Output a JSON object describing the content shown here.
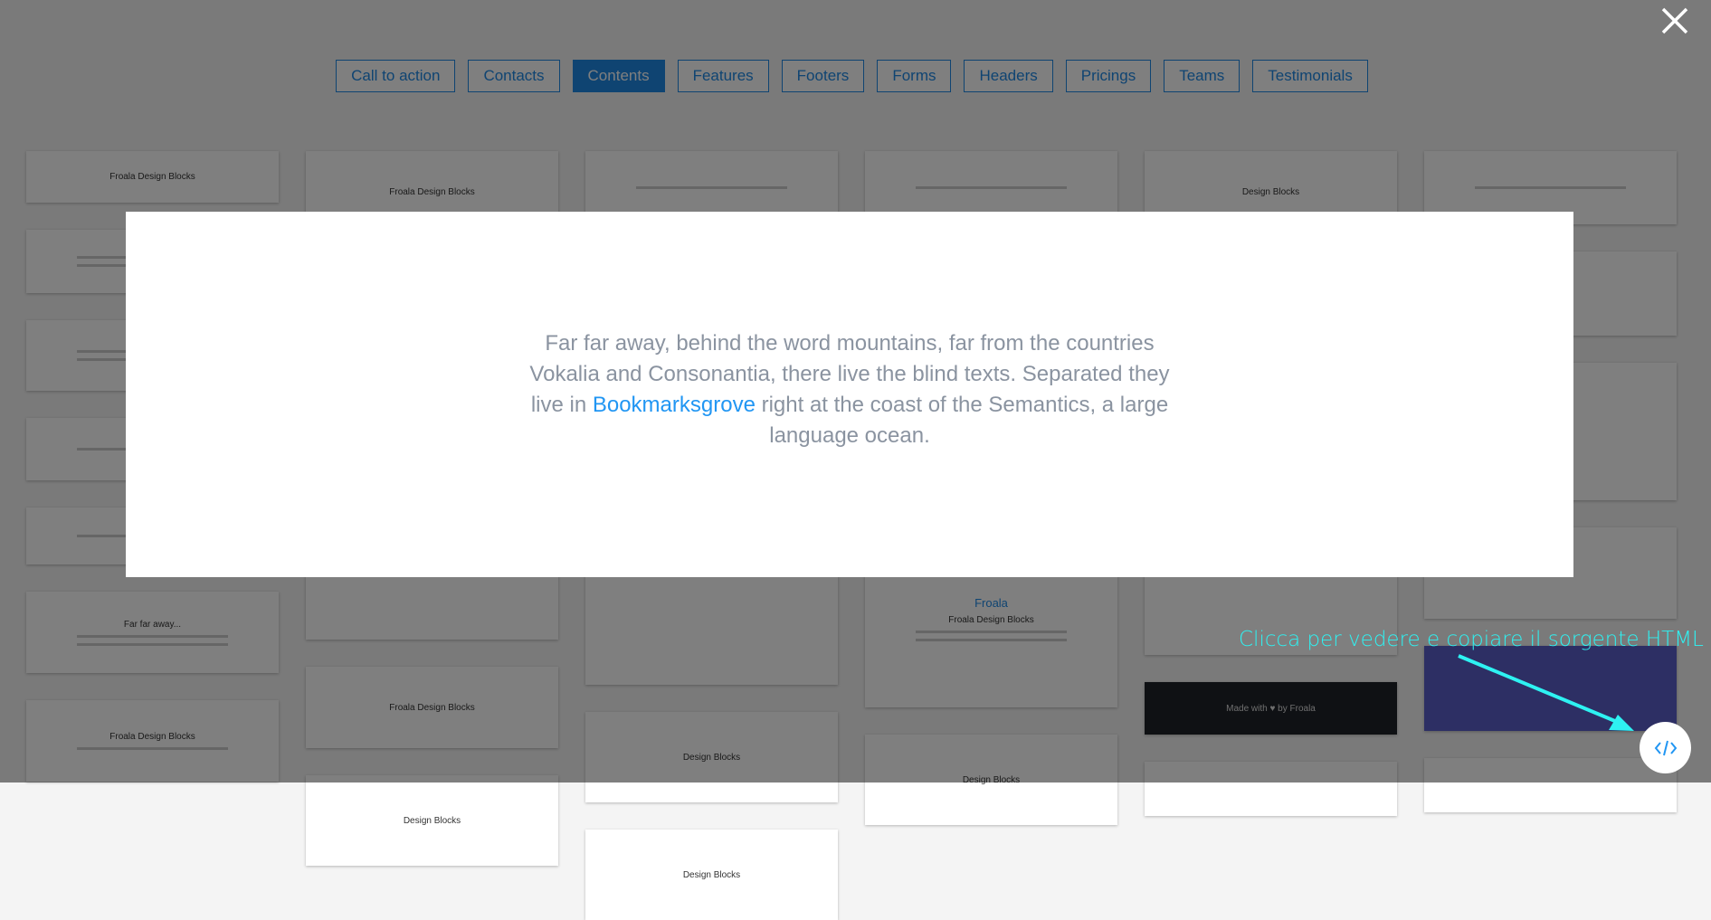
{
  "tabs": [
    {
      "label": "Call to action",
      "active": false
    },
    {
      "label": "Contacts",
      "active": false
    },
    {
      "label": "Contents",
      "active": true
    },
    {
      "label": "Features",
      "active": false
    },
    {
      "label": "Footers",
      "active": false
    },
    {
      "label": "Forms",
      "active": false
    },
    {
      "label": "Headers",
      "active": false
    },
    {
      "label": "Pricings",
      "active": false
    },
    {
      "label": "Teams",
      "active": false
    },
    {
      "label": "Testimonials",
      "active": false
    }
  ],
  "thumbnails": {
    "froala_design_blocks": "Froala Design Blocks",
    "design_blocks": "Design Blocks",
    "made_with": "Made with ♥ by Froala",
    "froala": "Froala",
    "far_far_away": "Far far away..."
  },
  "modal": {
    "text_before": "Far far away, behind the word mountains, far from the countries Vokalia and Consonantia, there live the blind texts. Separated they live in ",
    "link": "Bookmarksgrove",
    "text_after": " right at the coast of the Semantics, a large language ocean."
  },
  "hint": "Clicca per vedere e copiare il sorgente HTML",
  "icons": {
    "close": "close-icon",
    "code": "code-icon"
  },
  "colors": {
    "accent": "#1e88e5",
    "hint": "#2ef2f2",
    "link": "#2196f3"
  }
}
